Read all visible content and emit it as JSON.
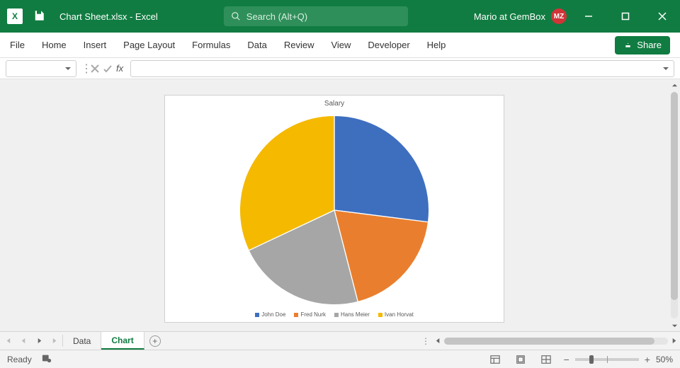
{
  "titlebar": {
    "app_abbrev": "X",
    "filename": "Chart Sheet.xlsx  -  Excel",
    "search_placeholder": "Search (Alt+Q)",
    "user_name": "Mario at GemBox",
    "user_initials": "MZ"
  },
  "ribbon": {
    "tabs": [
      "File",
      "Home",
      "Insert",
      "Page Layout",
      "Formulas",
      "Data",
      "Review",
      "View",
      "Developer",
      "Help"
    ],
    "share_label": "Share"
  },
  "formulabar": {
    "fx_label": "fx"
  },
  "sheet_tabs": {
    "tabs": [
      {
        "label": "Data",
        "active": false
      },
      {
        "label": "Chart",
        "active": true
      }
    ]
  },
  "statusbar": {
    "ready": "Ready",
    "zoom_label": "50%"
  },
  "colors": {
    "series": [
      "#3e6fbf",
      "#e97f2e",
      "#a6a6a6",
      "#f5b900"
    ]
  },
  "chart_data": {
    "type": "pie",
    "title": "Salary",
    "categories": [
      "John Doe",
      "Fred Nurk",
      "Hans Meier",
      "Ivan Horvat"
    ],
    "values": [
      27,
      19,
      22,
      32
    ],
    "legend_position": "bottom"
  }
}
